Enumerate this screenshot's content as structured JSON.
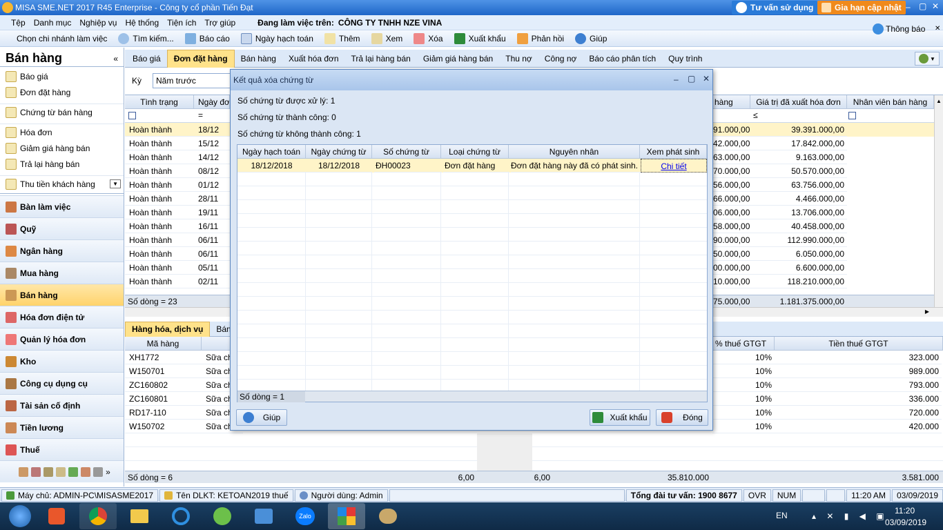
{
  "window": {
    "title": "MISA SME.NET 2017 R45 Enterprise - Công ty cổ phần Tiến Đạt",
    "consult_btn": "Tư vấn sử dụng",
    "renew_btn": "Gia hạn cập nhật"
  },
  "menu": [
    "Tệp",
    "Danh mục",
    "Nghiệp vụ",
    "Hệ thống",
    "Tiện ích",
    "Trợ giúp"
  ],
  "company": {
    "label": "Đang làm việc trên:",
    "name": "CÔNG TY TNHH NZE VINA"
  },
  "toolbar": {
    "branch": "Chọn chi nhánh làm việc",
    "search": "Tìm kiếm...",
    "report": "Báo cáo",
    "post_date": "Ngày hạch toán",
    "add": "Thêm",
    "view": "Xem",
    "delete": "Xóa",
    "export": "Xuất khẩu",
    "feedback": "Phản hồi",
    "help": "Giúp",
    "notify": "Thông báo"
  },
  "sidebar": {
    "title": "Bán hàng",
    "links": [
      "Báo giá",
      "Đơn đặt hàng",
      "Chứng từ bán hàng",
      "Hóa đơn",
      "Giảm giá hàng bán",
      "Trả lại hàng bán",
      "Thu tiền khách hàng"
    ],
    "modules": [
      "Bàn làm việc",
      "Quỹ",
      "Ngân hàng",
      "Mua hàng",
      "Bán hàng",
      "Hóa đơn điện tử",
      "Quản lý hóa đơn",
      "Kho",
      "Công cụ dụng cụ",
      "Tài sản cố định",
      "Tiền lương",
      "Thuế"
    ]
  },
  "tabs": [
    "Báo giá",
    "Đơn đặt hàng",
    "Bán hàng",
    "Xuất hóa đơn",
    "Trả lại hàng bán",
    "Giảm giá hàng bán",
    "Thu nợ",
    "Công nợ",
    "Báo cáo phân tích",
    "Quy trình"
  ],
  "filter": {
    "label": "Kỳ",
    "value": "Năm trước"
  },
  "main_grid": {
    "col_status": "Tình trạng",
    "col_date": "Ngày đơn",
    "col_amount": "hàng",
    "col_invoiced": "Giá trị đã xuất hóa đơn",
    "col_staff": "Nhân viên bán hàng",
    "filter_le": "≤",
    "filter_eq": "=",
    "rows": [
      {
        "status": "Hoàn thành",
        "date": "18/12",
        "amount": "91.000,00",
        "invoiced": "39.391.000,00"
      },
      {
        "status": "Hoàn thành",
        "date": "15/12",
        "amount": "42.000,00",
        "invoiced": "17.842.000,00"
      },
      {
        "status": "Hoàn thành",
        "date": "14/12",
        "amount": "63.000,00",
        "invoiced": "9.163.000,00"
      },
      {
        "status": "Hoàn thành",
        "date": "08/12",
        "amount": "70.000,00",
        "invoiced": "50.570.000,00"
      },
      {
        "status": "Hoàn thành",
        "date": "01/12",
        "amount": "56.000,00",
        "invoiced": "63.756.000,00"
      },
      {
        "status": "Hoàn thành",
        "date": "28/11",
        "amount": "66.000,00",
        "invoiced": "4.466.000,00"
      },
      {
        "status": "Hoàn thành",
        "date": "19/11",
        "amount": "06.000,00",
        "invoiced": "13.706.000,00"
      },
      {
        "status": "Hoàn thành",
        "date": "16/11",
        "amount": "58.000,00",
        "invoiced": "40.458.000,00"
      },
      {
        "status": "Hoàn thành",
        "date": "06/11",
        "amount": "90.000,00",
        "invoiced": "112.990.000,00"
      },
      {
        "status": "Hoàn thành",
        "date": "06/11",
        "amount": "50.000,00",
        "invoiced": "6.050.000,00"
      },
      {
        "status": "Hoàn thành",
        "date": "05/11",
        "amount": "00.000,00",
        "invoiced": "6.600.000,00"
      },
      {
        "status": "Hoàn thành",
        "date": "02/11",
        "amount": "10.000,00",
        "invoiced": "118.210.000,00"
      }
    ],
    "footer_count": "Số dòng = 23",
    "footer_amount": "75.000,00",
    "footer_invoiced": "1.181.375.000,00"
  },
  "detail": {
    "tab1": "Hàng hóa, dịch vụ",
    "tab2": "Bán",
    "col_code": "Mã hàng",
    "col_vat_rate": "% thuế GTGT",
    "col_vat": "Tiền thuế GTGT",
    "rows": [
      {
        "code": "XH1772",
        "desc": "Sữa chu",
        "rate": "10%",
        "vat": "323.000"
      },
      {
        "code": "W150701",
        "desc": "Sữa chu",
        "rate": "10%",
        "vat": "989.000"
      },
      {
        "code": "ZC160802",
        "desc": "Sữa chu",
        "rate": "10%",
        "vat": "793.000"
      },
      {
        "code": "ZC160801",
        "desc": "Sữa chu",
        "rate": "10%",
        "vat": "336.000"
      },
      {
        "code": "RD17-110",
        "desc": "Sữa chu",
        "rate": "10%",
        "vat": "720.000"
      },
      {
        "code": "W150702",
        "desc": "Sữa chu",
        "rate": "10%",
        "vat": "420.000"
      }
    ],
    "footer_count": "Số dòng = 6",
    "footer_q1": "6,00",
    "footer_q2": "6,00",
    "footer_amount": "35.810.000",
    "footer_vat": "3.581.000"
  },
  "dialog": {
    "title": "Kết quả xóa chứng từ",
    "processed": "Số chứng từ được xử lý: 1",
    "success": "Số chứng từ thành công: 0",
    "fail": "Số chứng từ không thành công: 1",
    "cols": [
      "Ngày hạch toán",
      "Ngày chứng từ",
      "Số chứng từ",
      "Loại chứng từ",
      "Nguyên nhân",
      "Xem phát sinh"
    ],
    "row": {
      "post_date": "18/12/2018",
      "doc_date": "18/12/2018",
      "doc_no": "ĐH00023",
      "doc_type": "Đơn đặt hàng",
      "reason": "Đơn đặt hàng này đã có phát sinh.",
      "link": "Chi tiết"
    },
    "footer": "Số dòng = 1",
    "help": "Giúp",
    "export": "Xuất khẩu",
    "close": "Đóng"
  },
  "status": {
    "server": "Máy chủ: ADMIN-PC\\MISASME2017",
    "db": "Tên DLKT: KETOAN2019 thuế",
    "user": "Người dùng: Admin",
    "hotline": "Tổng đài tư vấn: 1900 8677",
    "ovr": "OVR",
    "num": "NUM",
    "time": "11:20 AM",
    "date": "03/09/2019"
  },
  "taskbar": {
    "lang": "EN",
    "clock_time": "11:20",
    "clock_date": "03/09/2019",
    "zalo": "Zalo"
  }
}
